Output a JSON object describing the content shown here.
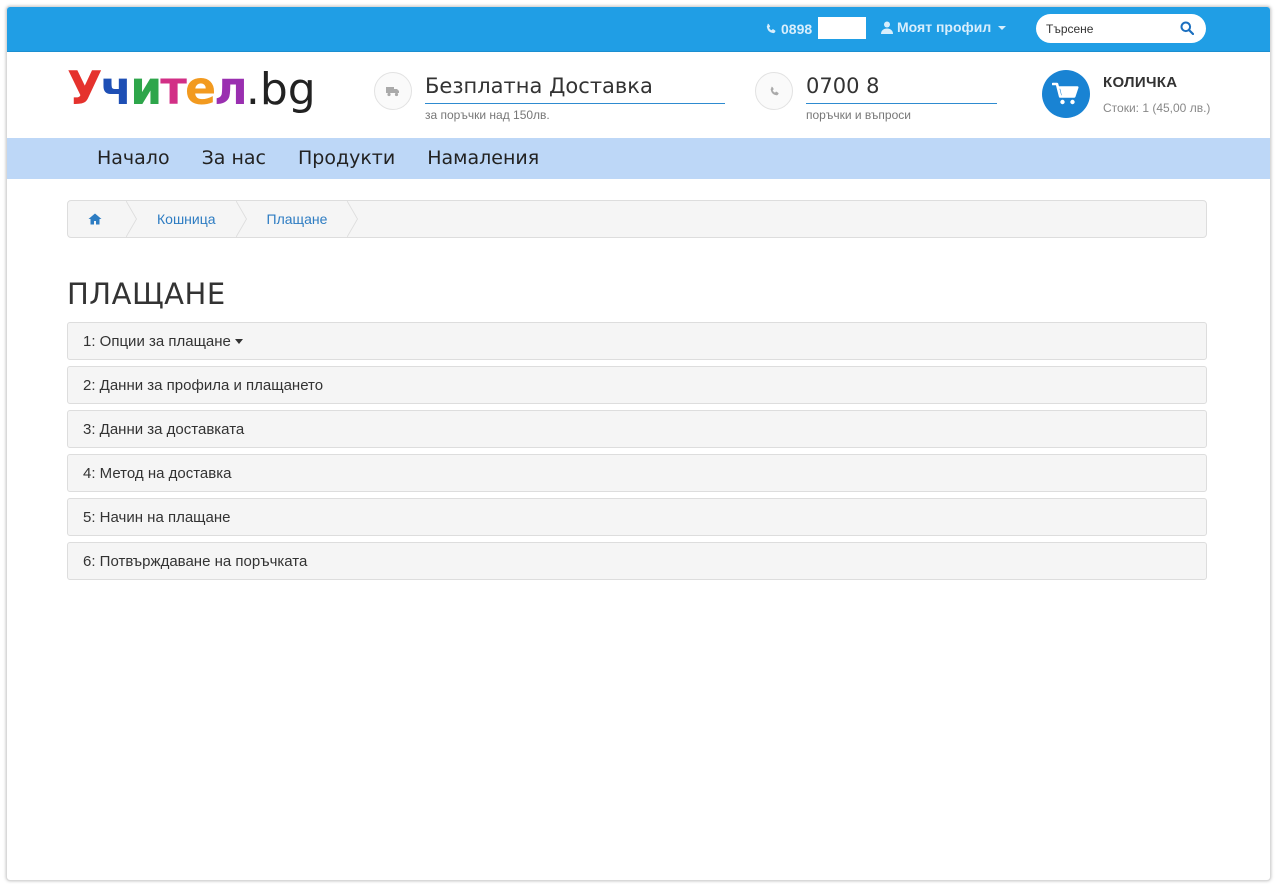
{
  "topbar": {
    "phone": "0898",
    "profile_label": "Моят профил",
    "search_placeholder": "Търсене"
  },
  "logo": {
    "letters": [
      {
        "char": "У",
        "color": "#e5322d"
      },
      {
        "char": "ч",
        "color": "#1e4fb5"
      },
      {
        "char": "и",
        "color": "#2ea64b"
      },
      {
        "char": "т",
        "color": "#d22f86"
      },
      {
        "char": "е",
        "color": "#f29a1f"
      },
      {
        "char": "л",
        "color": "#9a2fb0"
      }
    ],
    "suffix": ".bg"
  },
  "header": {
    "delivery": {
      "title": "Безплатна Доставка",
      "subtitle": "за поръчки над 150лв."
    },
    "phone": {
      "title": "0700 8",
      "subtitle": "поръчки и въпроси"
    },
    "cart": {
      "title": "КОЛИЧКА",
      "subtitle": "Стоки: 1 (45,00 лв.)"
    }
  },
  "nav": {
    "items": [
      {
        "label": "Начало"
      },
      {
        "label": "За нас"
      },
      {
        "label": "Продукти"
      },
      {
        "label": "Намаления"
      }
    ]
  },
  "breadcrumb": {
    "items": [
      {
        "label": "Кошница"
      },
      {
        "label": "Плащане"
      }
    ]
  },
  "page": {
    "title": "ПЛАЩАНЕ",
    "steps": [
      {
        "label": "1: Опции за плащане"
      },
      {
        "label": "2: Данни за профила и плащането"
      },
      {
        "label": "3: Данни за доставката"
      },
      {
        "label": "4: Метод на доставка"
      },
      {
        "label": "5: Начин на плащане"
      },
      {
        "label": "6: Потвърждаване на поръчката"
      }
    ]
  },
  "colors": {
    "topbar": "#209ee5",
    "nav": "#bdd7f7",
    "cart": "#1983d3",
    "link": "#2d7cc2"
  }
}
